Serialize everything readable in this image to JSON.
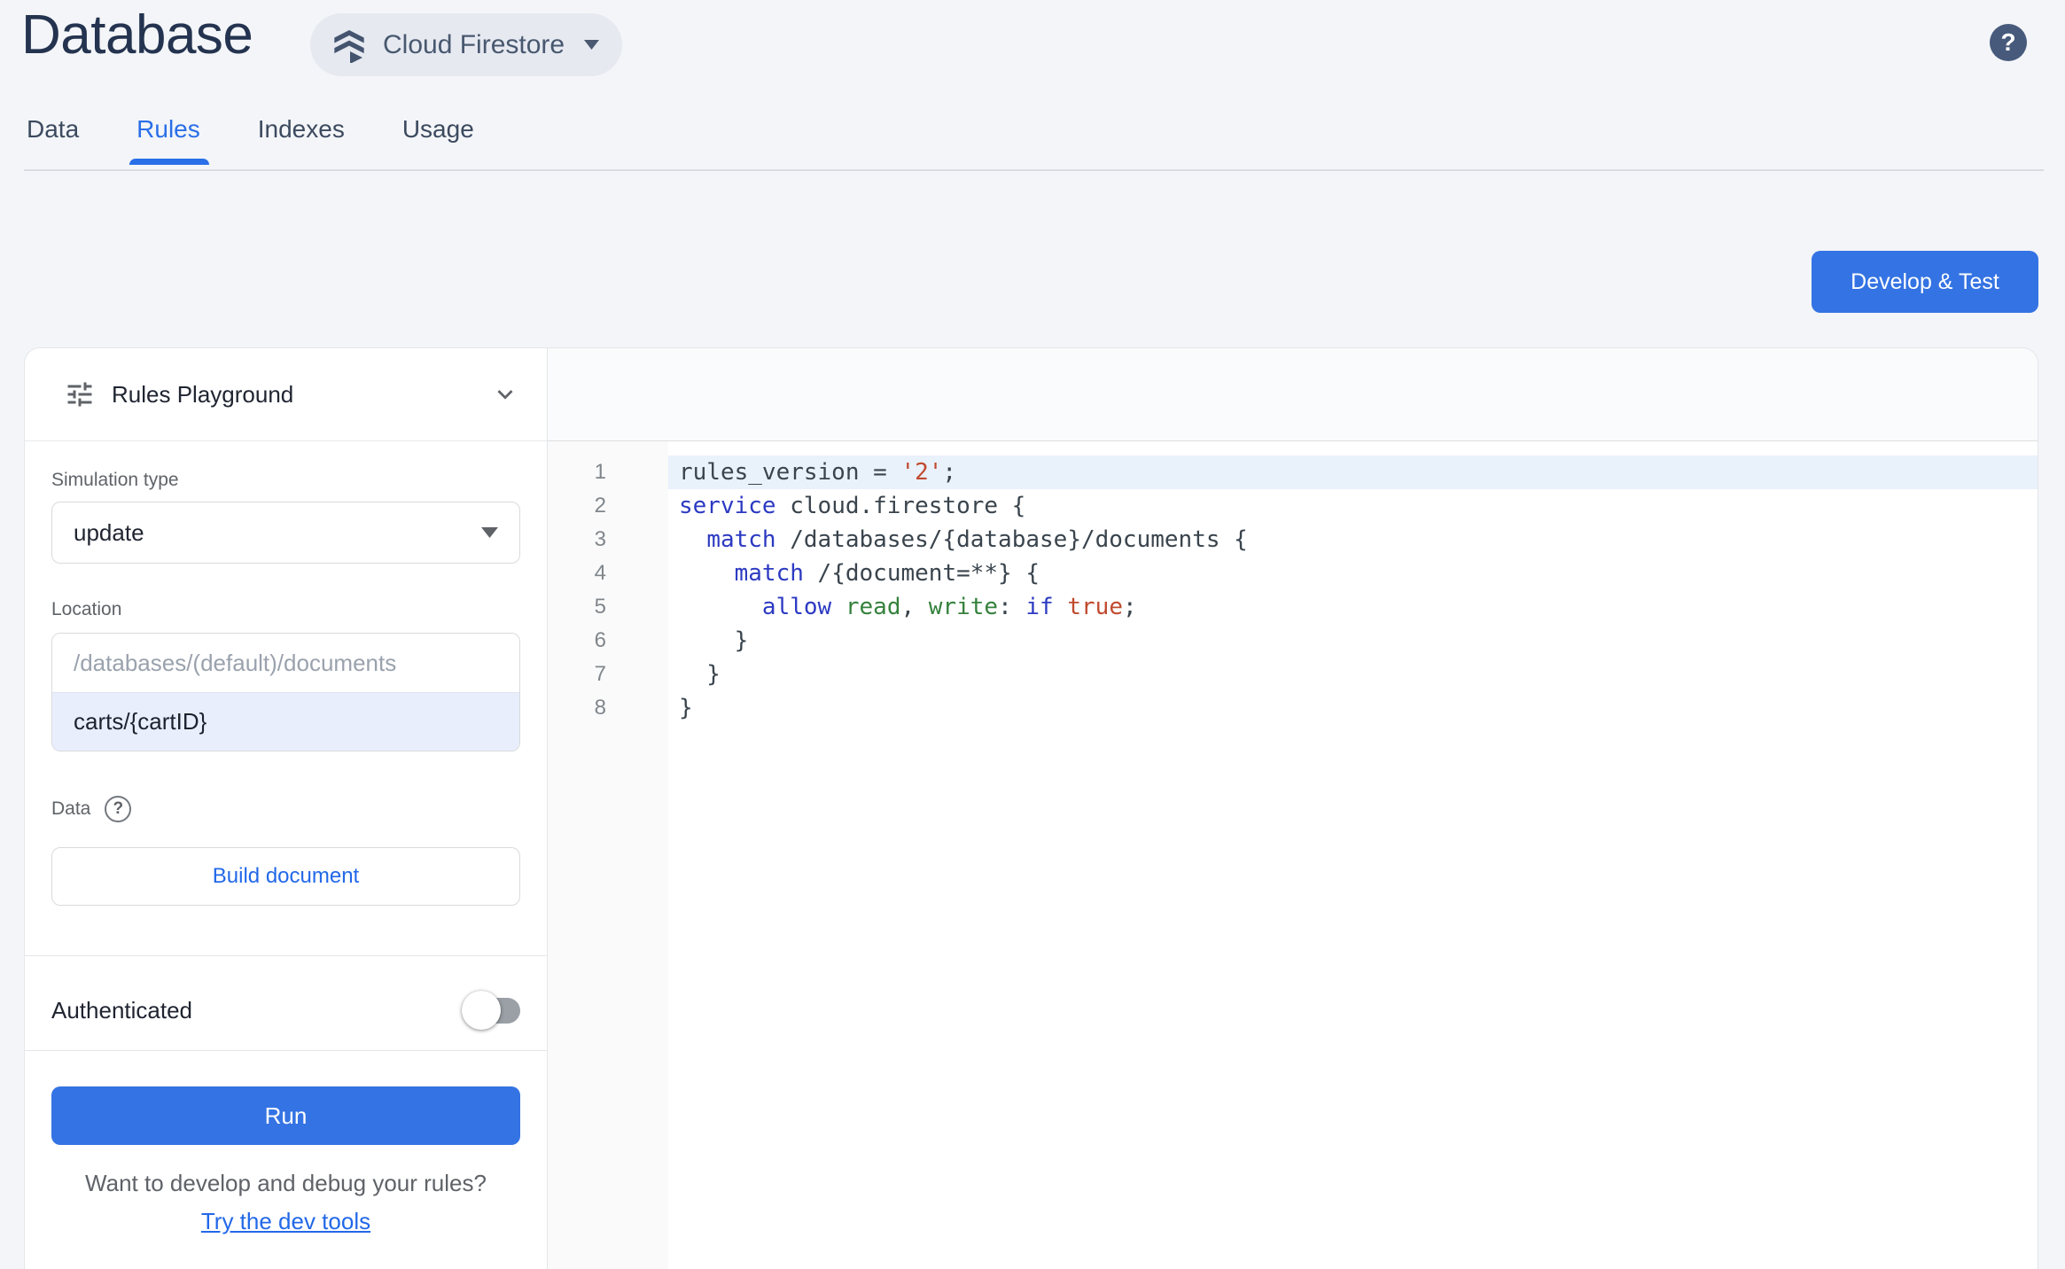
{
  "header": {
    "title": "Database",
    "product_selector": "Cloud Firestore",
    "help_glyph": "?"
  },
  "tabs": [
    {
      "label": "Data",
      "active": false
    },
    {
      "label": "Rules",
      "active": true
    },
    {
      "label": "Indexes",
      "active": false
    },
    {
      "label": "Usage",
      "active": false
    }
  ],
  "actions": {
    "develop_test_label": "Develop & Test"
  },
  "playground": {
    "title": "Rules Playground",
    "simulation_type_label": "Simulation type",
    "simulation_type_value": "update",
    "location_label": "Location",
    "location_prefix": "/databases/(default)/documents",
    "location_value": "carts/{cartID}",
    "data_label": "Data",
    "data_help_glyph": "?",
    "build_document_label": "Build document",
    "authenticated_label": "Authenticated",
    "authenticated_on": false,
    "run_label": "Run",
    "footer_question": "Want to develop and debug your rules?",
    "footer_link": "Try the dev tools"
  },
  "editor": {
    "active_line": 1,
    "lines": [
      [
        {
          "t": "rules_version = ",
          "c": "d"
        },
        {
          "t": "'2'",
          "c": "s"
        },
        {
          "t": ";",
          "c": "d"
        }
      ],
      [
        {
          "t": "service",
          "c": "k"
        },
        {
          "t": " cloud.firestore {",
          "c": "d"
        }
      ],
      [
        {
          "t": "  ",
          "c": "d"
        },
        {
          "t": "match",
          "c": "k"
        },
        {
          "t": " /databases/{database}/documents {",
          "c": "d"
        }
      ],
      [
        {
          "t": "    ",
          "c": "d"
        },
        {
          "t": "match",
          "c": "k"
        },
        {
          "t": " /{document=**} {",
          "c": "d"
        }
      ],
      [
        {
          "t": "      ",
          "c": "d"
        },
        {
          "t": "allow",
          "c": "k"
        },
        {
          "t": " ",
          "c": "d"
        },
        {
          "t": "read",
          "c": "g"
        },
        {
          "t": ", ",
          "c": "d"
        },
        {
          "t": "write",
          "c": "g"
        },
        {
          "t": ": ",
          "c": "d"
        },
        {
          "t": "if",
          "c": "k"
        },
        {
          "t": " ",
          "c": "d"
        },
        {
          "t": "true",
          "c": "s"
        },
        {
          "t": ";",
          "c": "d"
        }
      ],
      [
        {
          "t": "    }",
          "c": "d"
        }
      ],
      [
        {
          "t": "  }",
          "c": "d"
        }
      ],
      [
        {
          "t": "}",
          "c": "d"
        }
      ]
    ]
  },
  "colors": {
    "accent_link": "#2268e8",
    "primary_button": "#3473e3",
    "active_tab": "#2a6fe8",
    "code_keyword": "#2c3ac2",
    "code_string_literal": "#c04a2e",
    "code_permission": "#35813c",
    "code_default": "#3a444d",
    "active_line_highlight": "#e9f1fb",
    "help_fab_bg": "#485a7c"
  }
}
